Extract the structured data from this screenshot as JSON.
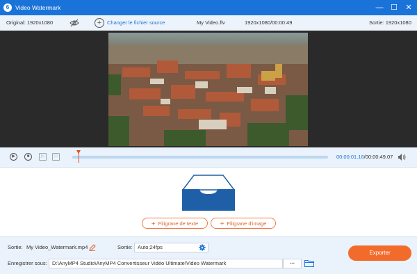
{
  "window": {
    "title": "Video Watermark",
    "minimize_glyph": "—",
    "maximize_glyph": "☐",
    "close_glyph": "✕"
  },
  "infobar": {
    "original": "Original: 1920x1080",
    "change_source": "Changer le fichier source",
    "filename": "My Video.flv",
    "info": "1920x1080/00:00:49",
    "output": "Sortie: 1920x1080"
  },
  "timeline": {
    "current": "00:00:01.16",
    "total": "/00:00:49.07"
  },
  "watermark": {
    "text_button": "Filigrane de texte",
    "image_button": "Filigrane d'image"
  },
  "bottom": {
    "sortie_label": "Sortie:",
    "filename": "My Video_Watermark.mp4",
    "format_label": "Sortie:",
    "format_value": "Auto;24fps",
    "save_label": "Enregistrer sous:",
    "save_path": "D:\\AnyMP4 Studio\\AnyMP4 Convertisseur Vidéo Ultimate\\Video Watermark",
    "browse": "···",
    "export": "Exporter"
  },
  "colors": {
    "accent": "#1a73d9",
    "orange": "#f26b2b"
  }
}
